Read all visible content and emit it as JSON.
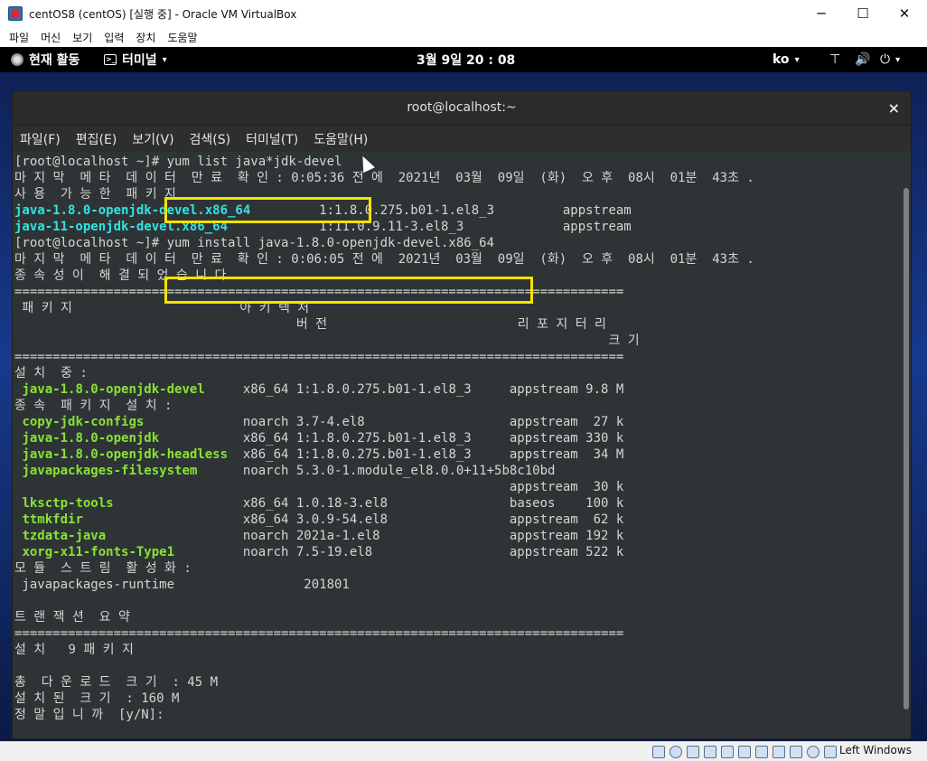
{
  "vbox": {
    "title": "centOS8 (centOS) [실행 중] - Oracle VM VirtualBox",
    "controls": {
      "minimize": "─",
      "maximize": "☐",
      "close": "✕"
    },
    "menu": [
      "파일",
      "머신",
      "보기",
      "입력",
      "장치",
      "도움말"
    ],
    "status_icons": [
      "hard-disk",
      "optical-drive",
      "audio",
      "network",
      "usb",
      "shared-folders",
      "display",
      "recording",
      "mouse-integration",
      "cpu",
      "host-key-indicator"
    ],
    "host_key": "Left Windows"
  },
  "gnome_topbar": {
    "activities": "현재 활동",
    "app_menu": "터미널",
    "clock": "3월 9일 20 : 08",
    "input_lang": "ko",
    "caret": "▾",
    "power_glyph": "⏻",
    "volume_glyph": "🔊",
    "network_glyph": "⊤"
  },
  "terminal": {
    "title": "root@localhost:~",
    "close": "×",
    "menu": [
      "파일(F)",
      "편집(E)",
      "보기(V)",
      "검색(S)",
      "터미널(T)",
      "도움말(H)"
    ],
    "highlight_color": "#f4e300",
    "lines": [
      [
        {
          "t": "[root@localhost ~]# yum list java*jdk-devel"
        }
      ],
      [
        {
          "t": "마 지 막  메 타  데 이 터  만 료  확 인 : 0:05:36 전 에  2021년  03월  09일  (화)  오 후  08시  01분  43초 ."
        }
      ],
      [
        {
          "t": "사 용  가 능 한  패 키 지"
        }
      ],
      [
        {
          "t": "java-1.8.0-openjdk-devel.x86_64",
          "c": "cyan"
        },
        {
          "t": "         1:1.8.0.275.b01-1.el8_3         appstream"
        }
      ],
      [
        {
          "t": "java-11-openjdk-devel.x86_64",
          "c": "cyan"
        },
        {
          "t": "            1:11.0.9.11-3.el8_3             appstream"
        }
      ],
      [
        {
          "t": "[root@localhost ~]# yum install java-1.8.0-openjdk-devel.x86_64"
        }
      ],
      [
        {
          "t": "마 지 막  메 타  데 이 터  만 료  확 인 : 0:06:05 전 에  2021년  03월  09일  (화)  오 후  08시  01분  43초 ."
        }
      ],
      [
        {
          "t": "종 속 성 이  해 결 되 었 습 니 다 ."
        }
      ],
      [
        {
          "t": "================================================================================"
        }
      ],
      [
        {
          "t": " 패 키 지                      아 키 텍 처"
        }
      ],
      [
        {
          "t": "                                     버 전                         리 포 지 터 리"
        }
      ],
      [
        {
          "t": "                                                                              크 기"
        }
      ],
      [
        {
          "t": "================================================================================"
        }
      ],
      [
        {
          "t": "설 치  중 :"
        }
      ],
      [
        {
          "t": " "
        },
        {
          "t": "java-1.8.0-openjdk-devel",
          "c": "green"
        },
        {
          "t": "     x86_64 1:1.8.0.275.b01-1.el8_3     appstream 9.8 M"
        }
      ],
      [
        {
          "t": "종 속  패 키 지  설 치 :"
        }
      ],
      [
        {
          "t": " "
        },
        {
          "t": "copy-jdk-configs",
          "c": "green"
        },
        {
          "t": "             noarch 3.7-4.el8                   appstream  27 k"
        }
      ],
      [
        {
          "t": " "
        },
        {
          "t": "java-1.8.0-openjdk",
          "c": "green"
        },
        {
          "t": "           x86_64 1:1.8.0.275.b01-1.el8_3     appstream 330 k"
        }
      ],
      [
        {
          "t": " "
        },
        {
          "t": "java-1.8.0-openjdk-headless",
          "c": "green"
        },
        {
          "t": "  x86_64 1:1.8.0.275.b01-1.el8_3     appstream  34 M"
        }
      ],
      [
        {
          "t": " "
        },
        {
          "t": "javapackages-filesystem",
          "c": "green"
        },
        {
          "t": "      noarch 5.3.0-1.module_el8.0.0+11+5b8c10bd"
        }
      ],
      [
        {
          "t": "                                                                 appstream  30 k"
        }
      ],
      [
        {
          "t": " "
        },
        {
          "t": "lksctp-tools",
          "c": "green"
        },
        {
          "t": "                 x86_64 1.0.18-3.el8                baseos    100 k"
        }
      ],
      [
        {
          "t": " "
        },
        {
          "t": "ttmkfdir",
          "c": "green"
        },
        {
          "t": "                     x86_64 3.0.9-54.el8                appstream  62 k"
        }
      ],
      [
        {
          "t": " "
        },
        {
          "t": "tzdata-java",
          "c": "green"
        },
        {
          "t": "                  noarch 2021a-1.el8                 appstream 192 k"
        }
      ],
      [
        {
          "t": " "
        },
        {
          "t": "xorg-x11-fonts-Type1",
          "c": "green"
        },
        {
          "t": "         noarch 7.5-19.el8                  appstream 522 k"
        }
      ],
      [
        {
          "t": "모 듈  스 트 림  활 성 화 :"
        }
      ],
      [
        {
          "t": " javapackages-runtime                 201801"
        }
      ],
      [
        {
          "t": ""
        }
      ],
      [
        {
          "t": "트 랜 잭 션  요 약"
        }
      ],
      [
        {
          "t": "================================================================================"
        }
      ],
      [
        {
          "t": "설 치   9 패 키 지"
        }
      ],
      [
        {
          "t": ""
        }
      ],
      [
        {
          "t": "총  다 운 로 드  크 기  : 45 M"
        }
      ],
      [
        {
          "t": "설 치 된  크 기  : 160 M"
        }
      ],
      [
        {
          "t": "정 말 입 니 까  [y/N]:"
        }
      ]
    ]
  }
}
